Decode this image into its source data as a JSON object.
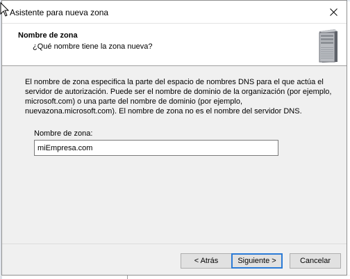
{
  "window": {
    "title": "Asistente para nueva zona",
    "close_icon": "close-icon"
  },
  "header": {
    "title": "Nombre de zona",
    "subtitle": "¿Qué nombre tiene la zona  nueva?",
    "icon": "server-icon"
  },
  "description": {
    "lines": [
      "El nombre de zona especifica la parte del espacio de nombres DNS para el que actúa el",
      "servidor de autorización. Puede ser el nombre de dominio de la organización (por ejemplo,",
      "microsoft.com) o una parte del nombre de dominio (por ejemplo,",
      "nuevazona.microsoft.com). El nombre de zona no es el nombre del servidor DNS."
    ]
  },
  "zone_field": {
    "label": "Nombre de zona:",
    "value": "miEmpresa.com"
  },
  "buttons": {
    "back": "< Atrás",
    "next": "Siguiente >",
    "cancel": "Cancelar"
  },
  "colors": {
    "default_button_border": "#2b7bd6",
    "dialog_background": "#f0f0f0",
    "header_background": "#ffffff"
  }
}
